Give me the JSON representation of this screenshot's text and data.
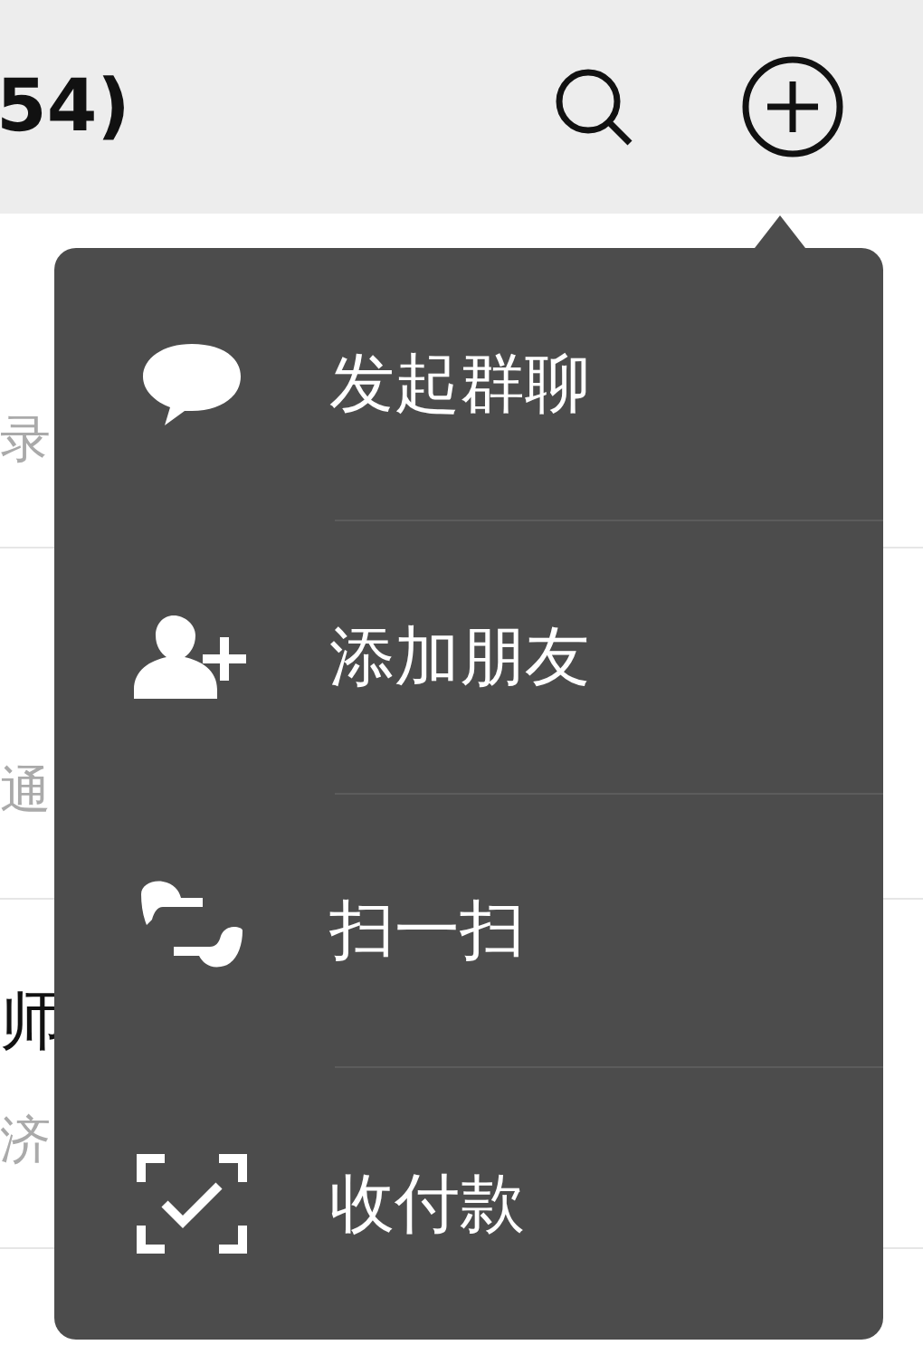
{
  "header": {
    "title": "54)"
  },
  "list": [
    {
      "kind": "sub",
      "texts": [
        "录"
      ]
    },
    {
      "kind": "sub",
      "texts": [
        "通"
      ]
    },
    {
      "kind": "titled",
      "texts": [
        "师",
        "济"
      ]
    }
  ],
  "menu": {
    "items": [
      {
        "kind": "group-chat",
        "label": "发起群聊"
      },
      {
        "kind": "add-friend",
        "label": "添加朋友"
      },
      {
        "kind": "scan",
        "label": "扫一扫"
      },
      {
        "kind": "pay",
        "label": "收付款"
      }
    ]
  }
}
